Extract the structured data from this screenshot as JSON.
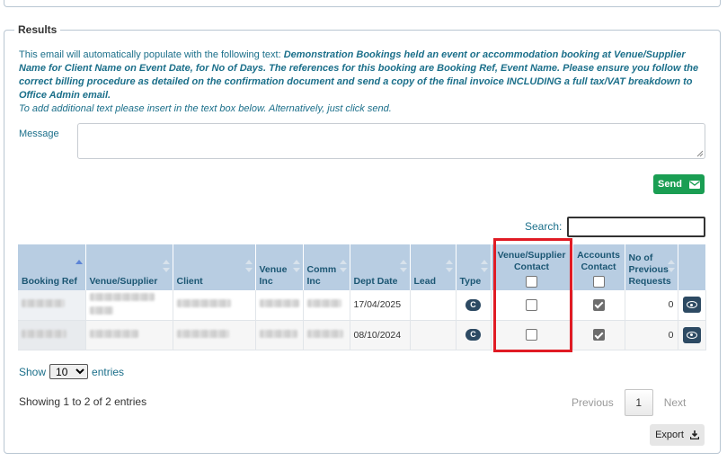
{
  "section": {
    "legend": "Results",
    "intro_plain": "This email will automatically populate with the following text: ",
    "intro_bold": "Demonstration Bookings held an event or accommodation booking at Venue/Supplier Name for Client Name on Event Date, for No of Days. The references for this booking are Booking Ref, Event Name. Please ensure you follow the correct billing procedure as detailed on the confirmation document and send a copy of the final invoice INCLUDING a full tax/VAT breakdown to Office Admin email.",
    "intro_note": "To add additional text please insert in the text box below. Alternatively, just click send."
  },
  "message": {
    "label": "Message",
    "value": ""
  },
  "send": {
    "label": "Send",
    "icon": "envelope-icon"
  },
  "search": {
    "label": "Search:",
    "value": ""
  },
  "table": {
    "columns": [
      {
        "key": "booking_ref",
        "label": "Booking Ref"
      },
      {
        "key": "venue_supplier",
        "label": "Venue/Supplier"
      },
      {
        "key": "client",
        "label": "Client"
      },
      {
        "key": "venue_inc",
        "label": "Venue Inc"
      },
      {
        "key": "comm_inc",
        "label": "Comm Inc"
      },
      {
        "key": "dept_date",
        "label": "Dept Date"
      },
      {
        "key": "lead",
        "label": "Lead"
      },
      {
        "key": "type",
        "label": "Type"
      },
      {
        "key": "venue_contact",
        "label": "Venue/Supplier Contact"
      },
      {
        "key": "accounts_contact",
        "label": "Accounts Contact"
      },
      {
        "key": "previous_requests",
        "label": "No of Previous Requests"
      },
      {
        "key": "actions",
        "label": ""
      }
    ],
    "rows": [
      {
        "dept_date": "17/04/2025",
        "lead": "",
        "type": "C",
        "venue_contact": false,
        "accounts_contact": true,
        "previous_requests": "0"
      },
      {
        "dept_date": "08/10/2024",
        "lead": "",
        "type": "C",
        "venue_contact": false,
        "accounts_contact": true,
        "previous_requests": "0"
      }
    ]
  },
  "length": {
    "show": "Show",
    "selected": "10",
    "entries": "entries"
  },
  "info": {
    "text": "Showing 1 to 2 of 2 entries"
  },
  "pagination": {
    "previous": "Previous",
    "current": "1",
    "next": "Next"
  },
  "export": {
    "label": "Export",
    "icon": "download-icon"
  },
  "colors": {
    "accent_text": "#1b6f8a",
    "header_bg": "#b8cde2",
    "send_green": "#1a9e53",
    "badge_navy": "#2d4a63",
    "highlight_red": "#e01b24"
  }
}
